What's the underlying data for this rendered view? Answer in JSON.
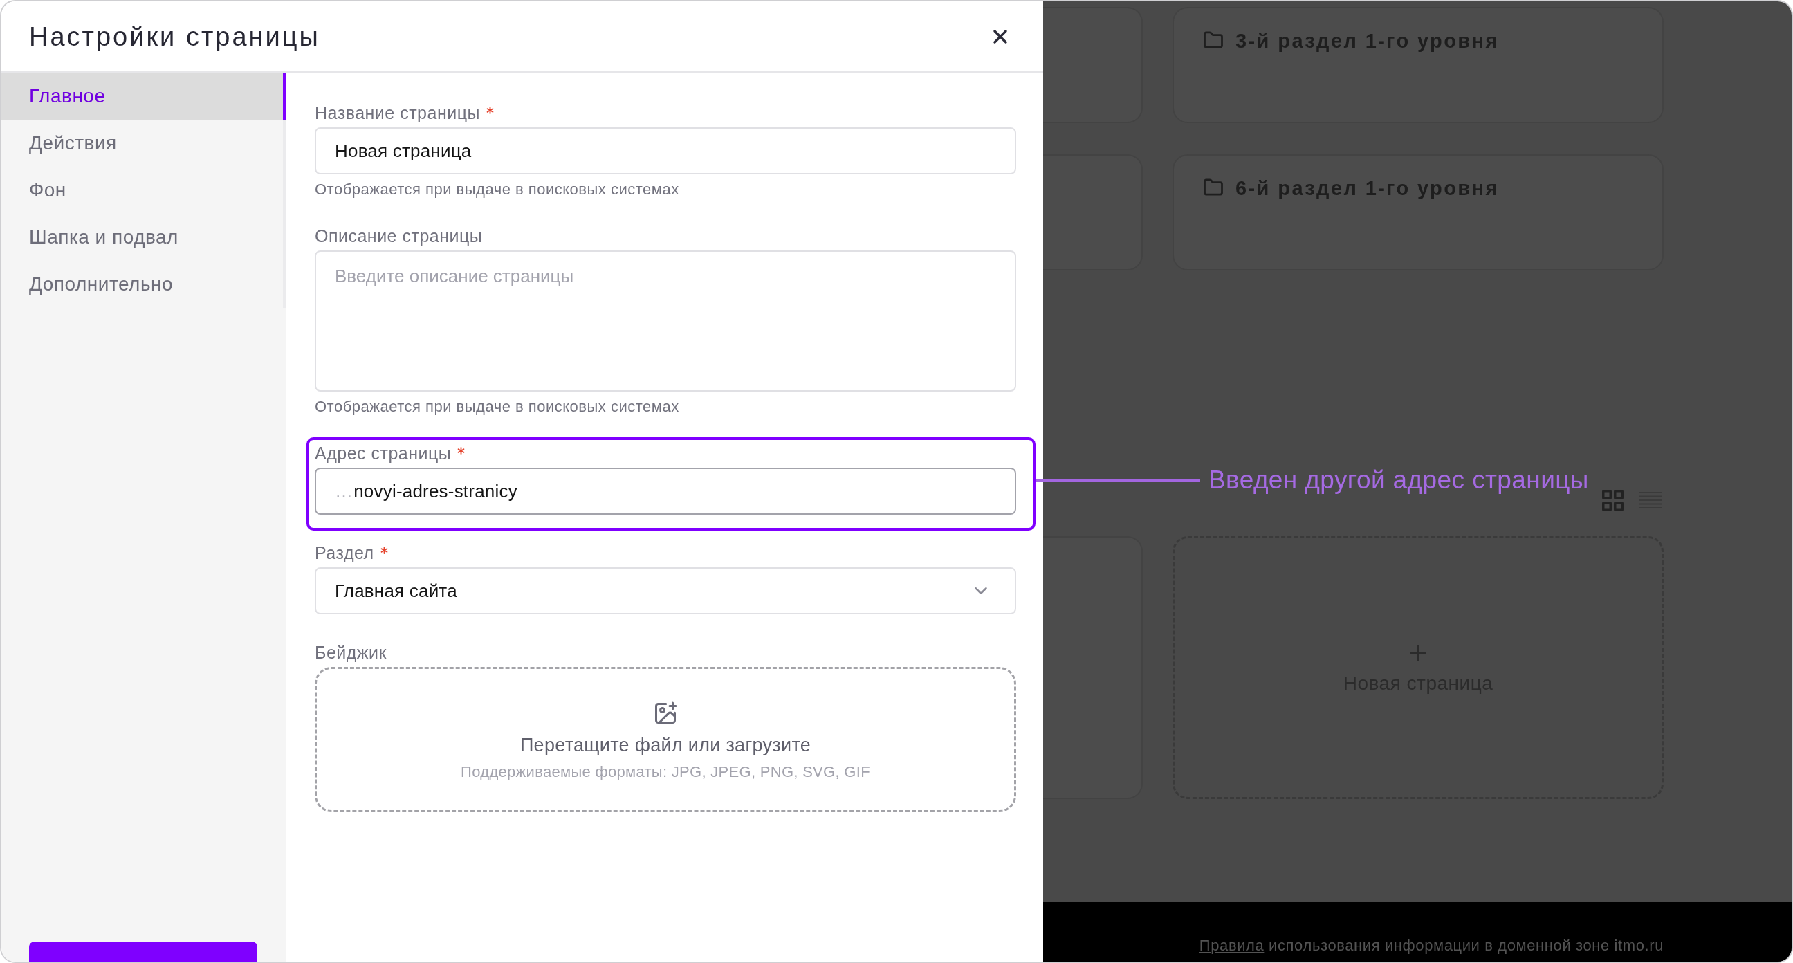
{
  "modal": {
    "title": "Настройки страницы"
  },
  "sidebar": {
    "items": [
      {
        "label": "Главное",
        "selected": true
      },
      {
        "label": "Действия",
        "selected": false
      },
      {
        "label": "Фон",
        "selected": false
      },
      {
        "label": "Шапка и подвал",
        "selected": false
      },
      {
        "label": "Дополнительно",
        "selected": false
      }
    ]
  },
  "form": {
    "fields": [
      {
        "kind": "input",
        "label": "Название страницы",
        "required": true,
        "highlighted": false,
        "value": "Новая страница",
        "hint": "Отображается при выдаче в поисковых системах"
      },
      {
        "kind": "textarea",
        "label": "Описание страницы",
        "required": false,
        "highlighted": false,
        "placeholder": "Введите описание страницы",
        "hint": "Отображается при выдаче в поисковых системах"
      },
      {
        "kind": "input",
        "label": "Адрес страницы",
        "required": true,
        "highlighted": true,
        "prefix": "…",
        "value": "novyi-adres-stranicy"
      },
      {
        "kind": "select",
        "label": "Раздел",
        "required": true,
        "highlighted": false,
        "value": "Главная сайта"
      },
      {
        "kind": "upload",
        "label": "Бейджик",
        "required": false,
        "highlighted": false,
        "text": "Перетащите файл или загрузите",
        "formats": "Поддерживаемые форматы: JPG, JPEG, PNG, SVG, GIF"
      }
    ]
  },
  "annotation": {
    "text": "Введен другой адрес страницы"
  },
  "background": {
    "sections": [
      {
        "title": "3-й раздел 1-го уровня"
      },
      {
        "title": "6-й раздел 1-го уровня"
      }
    ],
    "view_modes": [
      {
        "kind": "grid",
        "selected": true
      },
      {
        "kind": "list",
        "selected": false
      }
    ],
    "new_page": {
      "label": "Новая страница"
    },
    "footer": {
      "link": "Правила",
      "text": "использования информации в доменной зоне itmo.ru"
    }
  }
}
